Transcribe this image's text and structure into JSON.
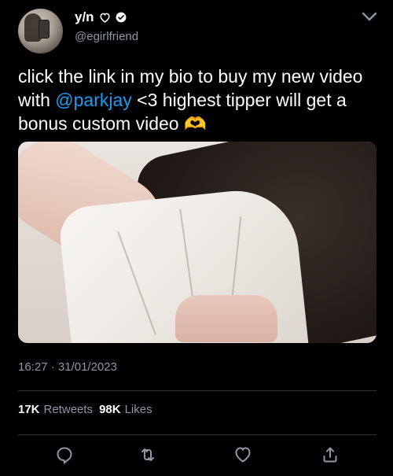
{
  "author": {
    "display_name": "y/n",
    "handle": "@egirlfriend",
    "name_icons": [
      "heart-outline-icon",
      "verified-badge-icon"
    ]
  },
  "tweet": {
    "text_before_mention": "click the link in my bio to buy my new video with ",
    "mention": "@parkjay",
    "text_after_mention": " <3 highest tipper will get a bonus custom video ",
    "emoji": "🫶"
  },
  "meta": {
    "time": "16:27",
    "separator": "·",
    "date": "31/01/2023"
  },
  "stats": {
    "retweets_count": "17K",
    "retweets_label": "Retweets",
    "likes_count": "98K",
    "likes_label": "Likes"
  },
  "actions": [
    "reply-icon",
    "retweet-icon",
    "like-icon",
    "share-icon"
  ],
  "colors": {
    "background": "#000000",
    "text": "#ffffff",
    "secondary": "#8b98a5",
    "mention": "#1d9bf0",
    "divider": "#2f3336"
  }
}
